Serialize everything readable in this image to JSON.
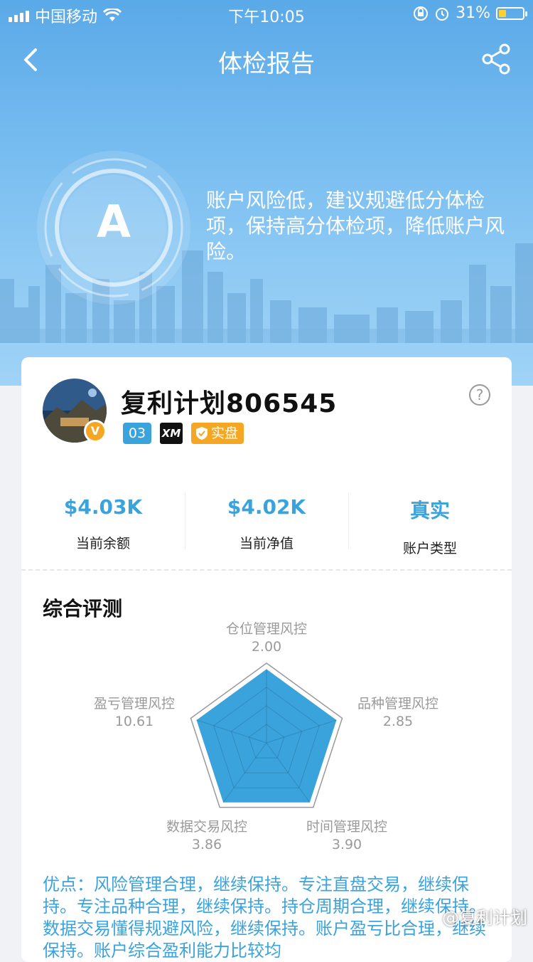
{
  "status_bar": {
    "carrier": "中国移动",
    "time": "下午10:05",
    "battery": "31%",
    "battery_level": 0.31
  },
  "nav": {
    "title": "体检报告"
  },
  "grade": {
    "letter": "A"
  },
  "summary": "账户风险低，建议规避低分体检项，保持高分体检项，降低账户风险。",
  "account": {
    "name": "复利计划806545",
    "tag_number": "03",
    "broker_logo": "XM",
    "real_tag": "实盘",
    "badge": "V"
  },
  "help_icon": "?",
  "stats": [
    {
      "value": "$4.03K",
      "label": "当前余额"
    },
    {
      "value": "$4.02K",
      "label": "当前净值"
    },
    {
      "value": "真实",
      "label": "账户类型"
    }
  ],
  "section_title": "综合评测",
  "chart_data": {
    "type": "radar",
    "axes": [
      "仓位管理风控",
      "品种管理风控",
      "时间管理风控",
      "数据交易风控",
      "盈亏管理风控"
    ],
    "values": [
      2.0,
      2.85,
      3.9,
      3.86,
      10.61
    ],
    "value_labels": [
      "2.00",
      "2.85",
      "3.90",
      "3.86",
      "10.61"
    ],
    "fill_color": "#3aa3dc"
  },
  "pros_text": "优点：风险管理合理，继续保持。专注直盘交易，继续保持。专注品种合理，继续保持。持仓周期合理，继续保持。数据交易懂得规避风险，继续保持。账户盈亏比合理，继续保持。账户综合盈利能力比较均",
  "watermark": "@复利计划",
  "colors": {
    "accent": "#3aa3dc",
    "badge": "#f5a623",
    "header": "#5aa9e8"
  }
}
